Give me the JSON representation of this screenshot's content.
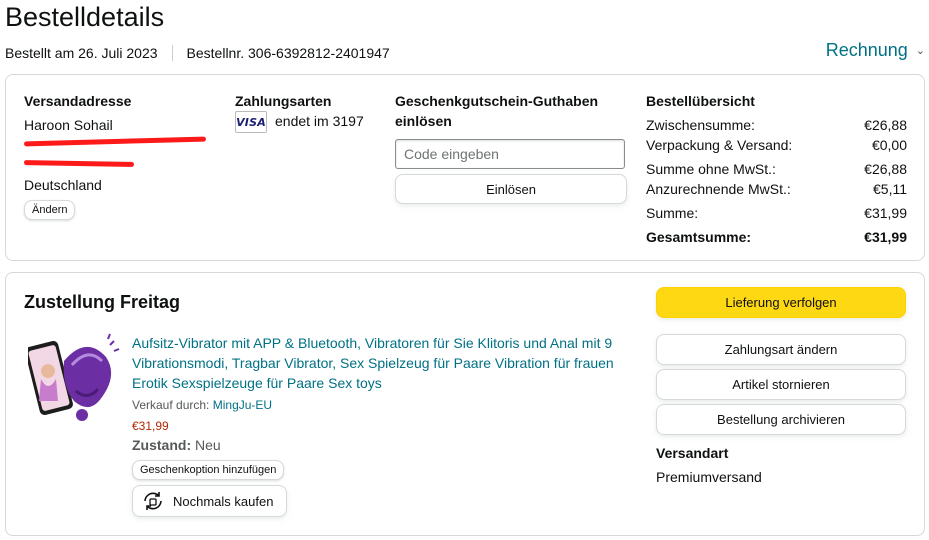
{
  "page": {
    "title": "Bestelldetails",
    "ordered_on": "Bestellt am 26. Juli 2023",
    "order_number": "Bestellnr. 306-6392812-2401947",
    "invoice_label": "Rechnung"
  },
  "shipping_address": {
    "heading": "Versandadresse",
    "name": "Haroon Sohail",
    "country": "Deutschland",
    "change_label": "Ändern"
  },
  "payment": {
    "heading": "Zahlungsarten",
    "card_brand": "VISA",
    "card_ending": "endet im 3197"
  },
  "gift_card": {
    "heading_line1": "Geschenkgutschein-Guthaben",
    "heading_line2": "einlösen",
    "input_placeholder": "Code eingeben",
    "redeem_label": "Einlösen"
  },
  "summary": {
    "heading": "Bestellübersicht",
    "rows": [
      {
        "label": "Zwischensumme:",
        "value": "€26,88"
      },
      {
        "label": "Verpackung & Versand:",
        "value": "€0,00"
      },
      {
        "label": "Summe ohne MwSt.:",
        "value": "€26,88"
      },
      {
        "label": "Anzurechnende MwSt.:",
        "value": "€5,11"
      },
      {
        "label": "Summe:",
        "value": "€31,99"
      },
      {
        "label": "Gesamtsumme:",
        "value": "€31,99"
      }
    ]
  },
  "delivery": {
    "heading": "Zustellung Freitag",
    "product_title": "Aufsitz-Vibrator mit APP & Bluetooth, Vibratoren für Sie Klitoris und Anal mit 9 Vibrationsmodi, Tragbar Vibrator, Sex Spielzeug für Paare Vibration für frauen Erotik Sexspielzeuge für Paare Sex toys",
    "sold_by_label": "Verkauf durch:",
    "seller": "MingJu-EU",
    "price": "€31,99",
    "condition_label": "Zustand:",
    "condition_value": "Neu",
    "gift_option_label": "Geschenkoption hinzufügen",
    "buy_again_label": "Nochmals kaufen"
  },
  "actions": {
    "track": "Lieferung verfolgen",
    "change_payment": "Zahlungsart ändern",
    "cancel_items": "Artikel stornieren",
    "archive_order": "Bestellung archivieren",
    "shipping_method_heading": "Versandart",
    "shipping_method_value": "Premiumversand"
  },
  "colors": {
    "link": "#007185",
    "price": "#b12704",
    "primary_button": "#ffd814",
    "redaction": "#ff1a1a",
    "product_purple": "#6b2fa3"
  }
}
